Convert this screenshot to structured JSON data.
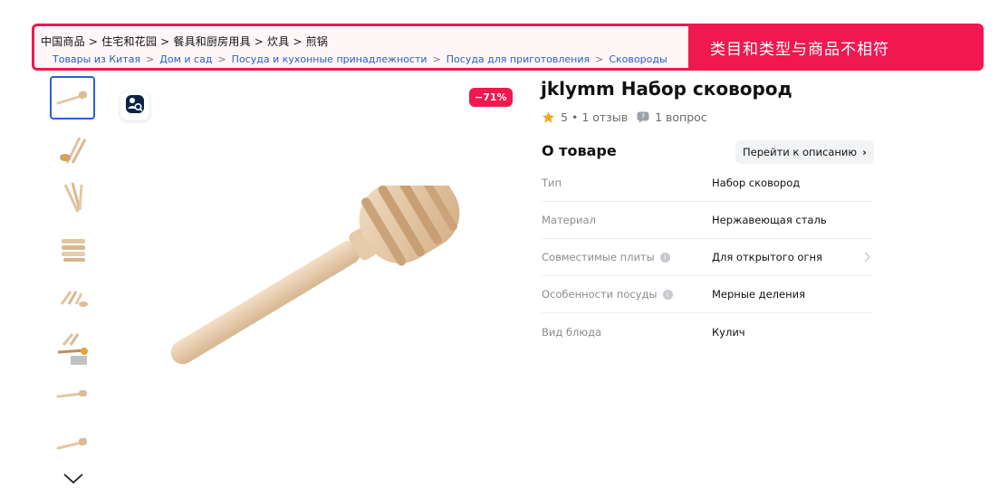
{
  "annotation": {
    "breadcrumb_cn": "中国商品 > 住宅和花园 > 餐具和厨房用具 > 炊具 > 煎锅",
    "breadcrumb_ru": [
      "Товары из Китая",
      "Дом и сад",
      "Посуда и кухонные принадлежности",
      "Посуда для приготовления",
      "Сковороды"
    ],
    "separator": ">",
    "verdict": "类目和类型与商品不相符",
    "colors": {
      "accent": "#f0184f",
      "link": "#2a5fc5"
    }
  },
  "gallery": {
    "thumbnail_count": 8,
    "active_index": 0,
    "discount": "−71%",
    "icons": {
      "lens": "search-photo-icon",
      "more": "chevron-down-icon"
    }
  },
  "product": {
    "title": "jklymm Набор сковород",
    "rating": "5",
    "reviews": "1 отзыв",
    "rating_separator": "•",
    "questions": "1 вопрос"
  },
  "about": {
    "heading": "О товаре",
    "to_description": "Перейти к описанию",
    "specs": [
      {
        "key": "Тип",
        "value": "Набор сковород",
        "info": false,
        "arrow": false
      },
      {
        "key": "Материал",
        "value": "Нержавеющая сталь",
        "info": false,
        "arrow": false
      },
      {
        "key": "Совместимые плиты",
        "value": "Для открытого огня",
        "info": true,
        "arrow": true
      },
      {
        "key": "Особенности посуды",
        "value": "Мерные деления",
        "info": true,
        "arrow": false
      },
      {
        "key": "Вид блюда",
        "value": "Кулич",
        "info": false,
        "arrow": false
      }
    ]
  }
}
